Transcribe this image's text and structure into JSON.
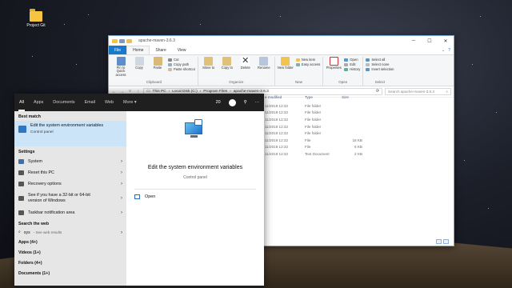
{
  "desktop": {
    "icon_label": "Project Git"
  },
  "explorer": {
    "title": "apache-maven-3.6.3",
    "ribbon_tabs": [
      "File",
      "Home",
      "Share",
      "View"
    ],
    "clipboard": {
      "pin": "Pin to Quick access",
      "copy": "Copy",
      "paste": "Paste",
      "cut": "Cut",
      "copy_path": "Copy path",
      "paste_shortcut": "Paste shortcut",
      "label": "Clipboard"
    },
    "organize": {
      "move": "Move to",
      "copy": "Copy to",
      "delete": "Delete",
      "rename": "Rename",
      "label": "Organize"
    },
    "new": {
      "folder": "New folder",
      "new_item": "New item",
      "easy_access": "Easy access",
      "label": "New"
    },
    "open": {
      "properties": "Properties",
      "open": "Open",
      "edit": "Edit",
      "history": "History",
      "label": "Open"
    },
    "select": {
      "all": "Select all",
      "none": "Select none",
      "invert": "Invert selection",
      "label": "Select"
    },
    "breadcrumb": [
      "This PC",
      "Local Disk (C:)",
      "Program Files",
      "apache-maven-3.6.3"
    ],
    "search_placeholder": "Search apache-maven-3.6.3",
    "columns": {
      "modified": "e modified",
      "type": "Type",
      "size": "Size"
    },
    "files": [
      {
        "modified": "11/2019 12:32",
        "type": "File folder",
        "size": ""
      },
      {
        "modified": "11/2019 12:32",
        "type": "File folder",
        "size": ""
      },
      {
        "modified": "11/2019 12:32",
        "type": "File folder",
        "size": ""
      },
      {
        "modified": "11/2019 12:32",
        "type": "File folder",
        "size": ""
      },
      {
        "modified": "11/2019 12:32",
        "type": "File folder",
        "size": ""
      },
      {
        "modified": "11/2019 12:32",
        "type": "File",
        "size": "18 KB"
      },
      {
        "modified": "11/2019 12:32",
        "type": "File",
        "size": "6 KB"
      },
      {
        "modified": "11/2019 12:32",
        "type": "Text Document",
        "size": "2 KB"
      }
    ]
  },
  "start_menu": {
    "tabs": [
      "All",
      "Apps",
      "Documents",
      "Email",
      "Web",
      "More ▾"
    ],
    "points": "20",
    "best_match_heading": "Best match",
    "best_match": {
      "title": "Edit the system environment variables",
      "subtitle": "Control panel"
    },
    "settings_heading": "Settings",
    "settings": [
      "System",
      "Reset this PC",
      "Recovery options",
      "See if you have a 32-bit or 64-bit version of Windows",
      "Taskbar notification area"
    ],
    "web_heading": "Search the web",
    "web_query": "sys",
    "web_hint": "- See web results",
    "categories": [
      "Apps (4+)",
      "Videos (1+)",
      "Folders (4+)",
      "Documents (1+)"
    ],
    "preview": {
      "title": "Edit the system environment variables",
      "subtitle": "Control panel",
      "open": "Open"
    }
  }
}
